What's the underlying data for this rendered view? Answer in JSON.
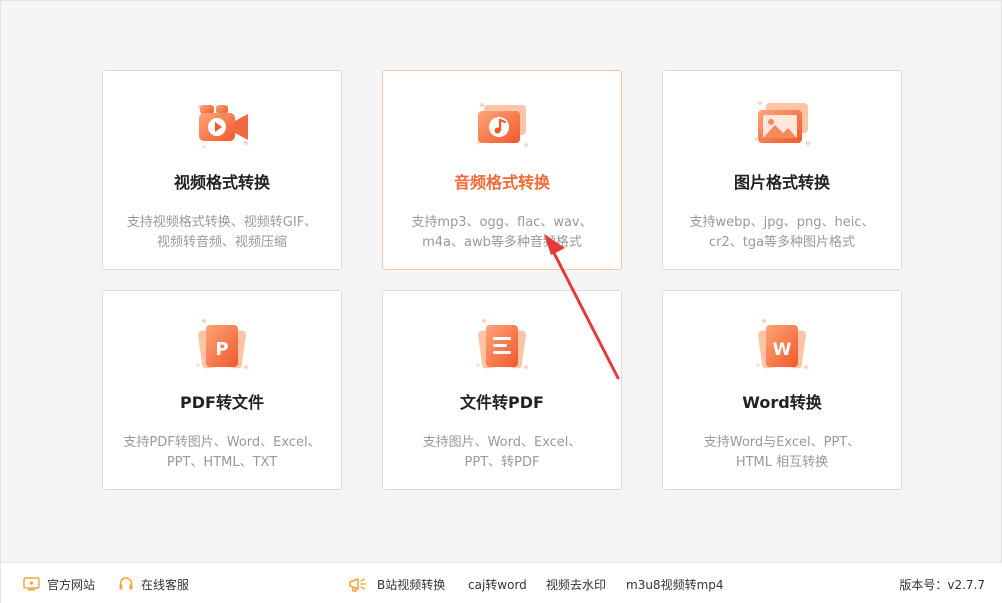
{
  "cards": [
    {
      "title": "视频格式转换",
      "desc1": "支持视频格式转换、视频转GIF、",
      "desc2": "视频转音频、视频压缩"
    },
    {
      "title": "音频格式转换",
      "desc1": "支持mp3、ogg、flac、wav、",
      "desc2": "m4a、awb等多种音频格式"
    },
    {
      "title": "图片格式转换",
      "desc1": "支持webp、jpg、png、heic、",
      "desc2": "cr2、tga等多种图片格式"
    },
    {
      "title": "PDF转文件",
      "desc1": "支持PDF转图片、Word、Excel、",
      "desc2": "PPT、HTML、TXT"
    },
    {
      "title": "文件转PDF",
      "desc1": "支持图片、Word、Excel、",
      "desc2": "PPT、转PDF"
    },
    {
      "title": "Word转换",
      "desc1": "支持Word与Excel、PPT、",
      "desc2": "HTML 相互转换"
    }
  ],
  "icons": {
    "pdf_letter": "P",
    "word_letter": "W"
  },
  "footer": {
    "website": "官方网站",
    "support": "在线客服",
    "bilibili": "B站视频转换",
    "caj": "caj转word",
    "watermark": "视频去水印",
    "m3u8": "m3u8视频转mp4",
    "version": "版本号：v2.7.7"
  },
  "colors": {
    "accent": "#f26b3a",
    "accent_light": "#ffb08a",
    "arrow": "#e8393a"
  }
}
